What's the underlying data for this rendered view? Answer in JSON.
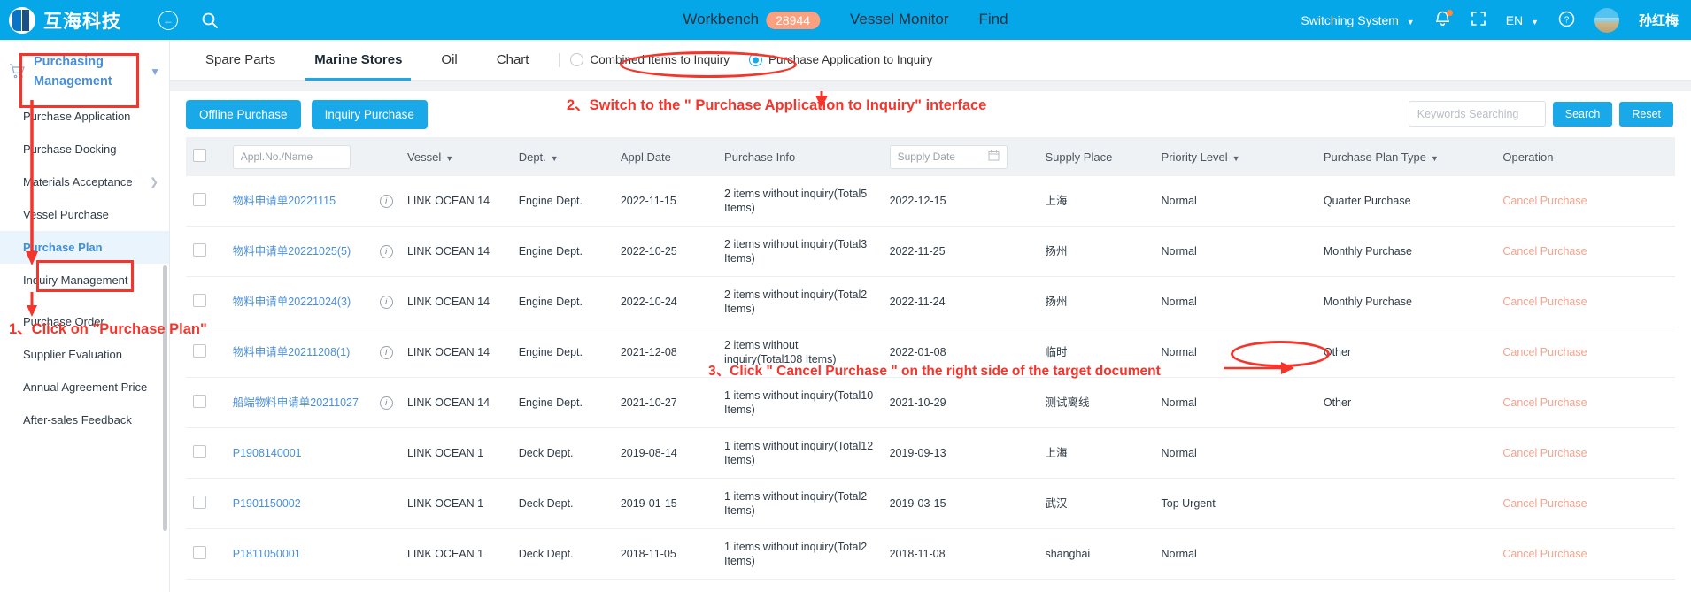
{
  "topbar": {
    "brand": "互海科技",
    "back_icon": "back-arrow-icon",
    "search_icon": "search-icon",
    "nav": [
      {
        "label": "Workbench",
        "badge": "28944"
      },
      {
        "label": "Vessel Monitor",
        "badge": ""
      },
      {
        "label": "Find",
        "badge": ""
      }
    ],
    "switching_system": "Switching System",
    "language": "EN",
    "bell_icon": "bell-icon",
    "fullscreen_icon": "fullscreen-icon",
    "help_icon": "help-icon",
    "username": "孙红梅"
  },
  "sidebar": {
    "title_line1": "Purchasing",
    "title_line2": "Management",
    "cart_icon": "cart-icon",
    "chevron": "chevron-down-icon",
    "items": [
      {
        "label": "Purchase Application",
        "active": false,
        "arrow": false
      },
      {
        "label": "Purchase Docking",
        "active": false,
        "arrow": false
      },
      {
        "label": "Materials Acceptance",
        "active": false,
        "arrow": true
      },
      {
        "label": "Vessel Purchase",
        "active": false,
        "arrow": false
      },
      {
        "label": "Purchase Plan",
        "active": true,
        "arrow": false
      },
      {
        "label": "Inquiry Management",
        "active": false,
        "arrow": false
      },
      {
        "label": "Purchase Order",
        "active": false,
        "arrow": false
      },
      {
        "label": "Supplier Evaluation",
        "active": false,
        "arrow": false
      },
      {
        "label": "Annual Agreement Price",
        "active": false,
        "arrow": false
      },
      {
        "label": "After-sales Feedback",
        "active": false,
        "arrow": false
      }
    ]
  },
  "tabs": [
    {
      "label": "Spare Parts",
      "active": false
    },
    {
      "label": "Marine Stores",
      "active": true
    },
    {
      "label": "Oil",
      "active": false
    },
    {
      "label": "Chart",
      "active": false
    }
  ],
  "radios": [
    {
      "label": "Combined Items to Inquiry",
      "selected": false
    },
    {
      "label": "Purchase Application to Inquiry",
      "selected": true
    }
  ],
  "toolbar": {
    "offline_purchase": "Offline Purchase",
    "inquiry_purchase": "Inquiry Purchase",
    "keywords_placeholder": "Keywords Searching",
    "search_label": "Search",
    "reset_label": "Reset"
  },
  "table": {
    "headers": {
      "appl_no_placeholder": "Appl.No./Name",
      "vessel": "Vessel",
      "dept": "Dept.",
      "appl_date": "Appl.Date",
      "purchase_info": "Purchase Info",
      "supply_date_placeholder": "Supply Date",
      "supply_place": "Supply Place",
      "priority_level": "Priority Level",
      "purchase_plan_type": "Purchase Plan Type",
      "operation": "Operation"
    },
    "rows": [
      {
        "name": "物料申请单20221115",
        "vessel": "LINK OCEAN 14",
        "dept": "Engine Dept.",
        "appl_date": "2022-11-15",
        "purchase_info": "2 items without inquiry(Total5 Items)",
        "supply_date": "2022-12-15",
        "supply_place": "上海",
        "priority": "Normal",
        "priority_urgent": false,
        "plan_type": "Quarter Purchase",
        "operation": "Cancel Purchase",
        "has_info_icon": true
      },
      {
        "name": "物料申请单20221025(5)",
        "vessel": "LINK OCEAN 14",
        "dept": "Engine Dept.",
        "appl_date": "2022-10-25",
        "purchase_info": "2 items without inquiry(Total3 Items)",
        "supply_date": "2022-11-25",
        "supply_place": "扬州",
        "priority": "Normal",
        "priority_urgent": false,
        "plan_type": "Monthly Purchase",
        "operation": "Cancel Purchase",
        "has_info_icon": true
      },
      {
        "name": "物料申请单20221024(3)",
        "vessel": "LINK OCEAN 14",
        "dept": "Engine Dept.",
        "appl_date": "2022-10-24",
        "purchase_info": "2 items without inquiry(Total2 Items)",
        "supply_date": "2022-11-24",
        "supply_place": "扬州",
        "priority": "Normal",
        "priority_urgent": false,
        "plan_type": "Monthly Purchase",
        "operation": "Cancel Purchase",
        "has_info_icon": true
      },
      {
        "name": "物料申请单20211208(1)",
        "vessel": "LINK OCEAN 14",
        "dept": "Engine Dept.",
        "appl_date": "2021-12-08",
        "purchase_info": "2 items without inquiry(Total108 Items)",
        "supply_date": "2022-01-08",
        "supply_place": "临时",
        "priority": "Normal",
        "priority_urgent": false,
        "plan_type": "Other",
        "operation": "Cancel Purchase",
        "has_info_icon": true
      },
      {
        "name": "船端物料申请单20211027",
        "vessel": "LINK OCEAN 14",
        "dept": "Engine Dept.",
        "appl_date": "2021-10-27",
        "purchase_info": "1 items without inquiry(Total10 Items)",
        "supply_date": "2021-10-29",
        "supply_place": "测试离线",
        "priority": "Normal",
        "priority_urgent": false,
        "plan_type": "Other",
        "operation": "Cancel Purchase",
        "has_info_icon": true
      },
      {
        "name": "P1908140001",
        "vessel": "LINK OCEAN 1",
        "dept": "Deck Dept.",
        "appl_date": "2019-08-14",
        "purchase_info": "1 items without inquiry(Total12 Items)",
        "supply_date": "2019-09-13",
        "supply_place": "上海",
        "priority": "Normal",
        "priority_urgent": false,
        "plan_type": "",
        "operation": "Cancel Purchase",
        "has_info_icon": false
      },
      {
        "name": "P1901150002",
        "vessel": "LINK OCEAN 1",
        "dept": "Deck Dept.",
        "appl_date": "2019-01-15",
        "purchase_info": "1 items without inquiry(Total2 Items)",
        "supply_date": "2019-03-15",
        "supply_place": "武汉",
        "priority": "Top Urgent",
        "priority_urgent": true,
        "plan_type": "",
        "operation": "Cancel Purchase",
        "has_info_icon": false
      },
      {
        "name": "P1811050001",
        "vessel": "LINK OCEAN 1",
        "dept": "Deck Dept.",
        "appl_date": "2018-11-05",
        "purchase_info": "1 items without inquiry(Total2 Items)",
        "supply_date": "2018-11-08",
        "supply_place": "shanghai",
        "priority": "Normal",
        "priority_urgent": false,
        "plan_type": "",
        "operation": "Cancel Purchase",
        "has_info_icon": false
      }
    ]
  },
  "annotations": {
    "step1": "1、Click on \"Purchase Plan\"",
    "step2": "2、Switch to the \" Purchase Application to Inquiry\" interface",
    "step3": "3、Click \" Cancel  Purchase \" on the right side of the target document"
  },
  "colors": {
    "brand_blue": "#06A7E8",
    "accent_blue": "#19A8E8",
    "annotation_red": "#F5342B",
    "cancel_orange": "#F5A48D",
    "urgent_red": "#E8453C",
    "badge_peach": "#FCA080"
  }
}
